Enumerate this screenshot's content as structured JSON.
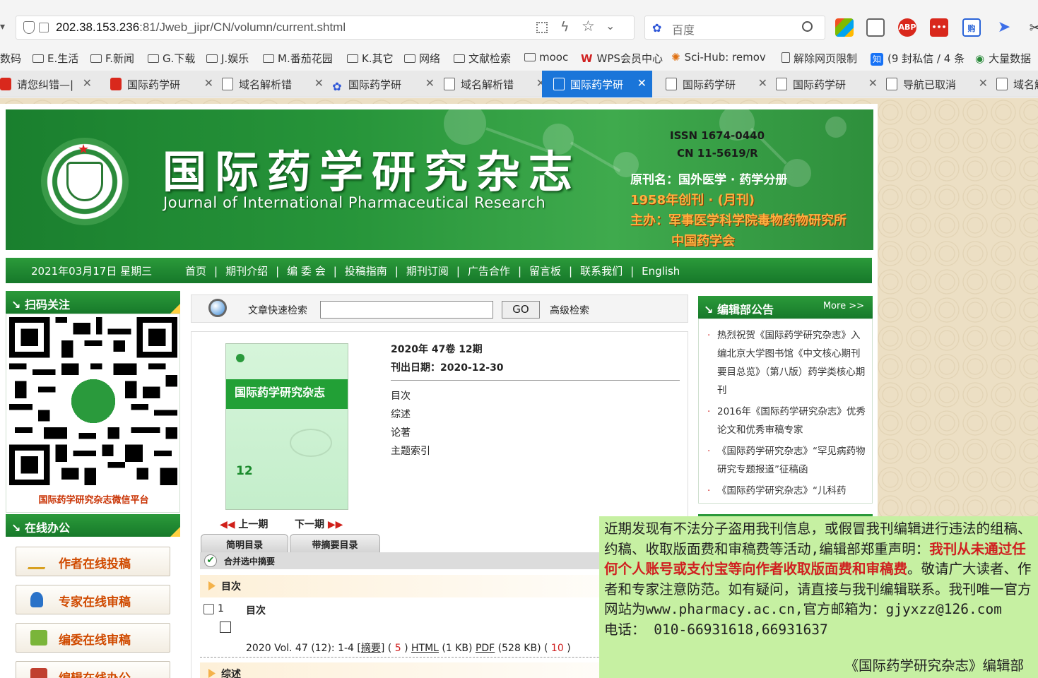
{
  "browser": {
    "url_host": "202.38.153.236",
    "url_rest": ":81/Jweb_jipr/CN/volumn/current.shtml",
    "search_placeholder": "百度",
    "extensions": [
      "windows-icon",
      "reader-icon",
      "ABP",
      "more-icon",
      "gou-icon",
      "bird-icon",
      "scissors-icon"
    ],
    "bookmarks": [
      {
        "label": "数码"
      },
      {
        "label": "E.生活"
      },
      {
        "label": "F.新闻"
      },
      {
        "label": "G.下载"
      },
      {
        "label": "J.娱乐"
      },
      {
        "label": "M.番茄花园"
      },
      {
        "label": "K.其它"
      },
      {
        "label": "网络"
      },
      {
        "label": "文献检索"
      },
      {
        "label": "mooc"
      },
      {
        "label": "WPS会员中心"
      },
      {
        "label": "Sci-Hub: remov"
      },
      {
        "label": "解除网页限制"
      },
      {
        "label": "(9 封私信 / 4 条"
      },
      {
        "label": "大量数据"
      }
    ],
    "tabs": [
      {
        "label": "请您纠错—|"
      },
      {
        "label": "国际药学研"
      },
      {
        "label": "域名解析错"
      },
      {
        "label": "国际药学研"
      },
      {
        "label": "域名解析错"
      },
      {
        "label": "国际药学研"
      },
      {
        "label": "国际药学研"
      },
      {
        "label": "国际药学研"
      },
      {
        "label": "导航已取消"
      },
      {
        "label": "域名解"
      }
    ]
  },
  "header": {
    "journal_cn": "国际药学研究杂志",
    "journal_en": "Journal of International Pharmaceutical Research",
    "issn": "ISSN 1674-0440",
    "cn": "CN 11-5619/R",
    "original_name": "原刊名：国外医学 · 药学分册",
    "founded": "1958年创刊 · (月刊)",
    "sponsor": "主办：军事医学科学院毒物药物研究所",
    "sponsor2": "中国药学会"
  },
  "nav": {
    "date": "2021年03月17日 星期三",
    "links": [
      "首页",
      "期刊介绍",
      "编 委 会",
      "投稿指南",
      "期刊订阅",
      "广告合作",
      "留言板",
      "联系我们",
      "English"
    ]
  },
  "left": {
    "qr_title": "扫码关注",
    "qr_caption": "国际药学研究杂志微信平台",
    "office_title": "在线办公",
    "services": [
      "作者在线投稿",
      "专家在线审稿",
      "编委在线审稿",
      "编辑在线办公"
    ]
  },
  "search": {
    "label": "文章快速检索",
    "go": "GO",
    "advanced": "高级检索"
  },
  "issue": {
    "cover_title": "国际药学研究杂志",
    "cover_number": "12",
    "line": "2020年 47卷 12期",
    "pubdate": "刊出日期：2020-12-30",
    "toc_links": [
      "目次",
      "综述",
      "论著",
      "主题索引"
    ],
    "prev": "上一期",
    "next": "下一期",
    "tab_brief": "简明目录",
    "tab_abstract": "带摘要目录",
    "merge_label": "合并选中摘要",
    "section1": "目次",
    "section2": "综述",
    "article": {
      "no": "1",
      "title": "目次",
      "meta_prefix": "2020 Vol. 47 (12): 1-4 [",
      "abstract": "摘要",
      "meta_mid1": "] ( ",
      "count1": "5",
      "meta_mid2": " ) ",
      "html": "HTML",
      "html_size": " (1 KB)  ",
      "pdf": "PDF",
      "pdf_size": " (528 KB)  ( ",
      "count2": "10",
      "meta_end": " )"
    }
  },
  "notices": {
    "title": "编辑部公告",
    "more": "More >>",
    "items": [
      {
        "text": "热烈祝贺《国际药学研究杂志》入编北京大学图书馆《中文核心期刊要目总览》（第八版）药学类核心期刊"
      },
      {
        "text": "2016年《国际药学研究杂志》优秀论文和优秀审稿专家"
      },
      {
        "text": "《国际药学研究杂志》“罕见病药物研究专题报道”征稿函"
      },
      {
        "text": "《国际药学研究杂志》“儿科药"
      }
    ]
  },
  "overlay": {
    "part1": "近期发现有不法分子盗用我刊信息，或假冒我刊编辑进行违法的组稿、约稿、收取版面费和审稿费等活动,编辑部郑重声明：",
    "red": "我刊从未通过任何个人账号或支付宝等向作者收取版面费和审稿费",
    "part2": "。敬请广大读者、作者和专家注意防范。如有疑问，请直接与我刊编辑联系。我刊唯一官方网站为www.pharmacy.ac.cn,官方邮箱为：gjyxzz@126.com",
    "phone": "电话：  010-66931618,66931637",
    "sign": "《国际药学研究杂志》编辑部"
  }
}
